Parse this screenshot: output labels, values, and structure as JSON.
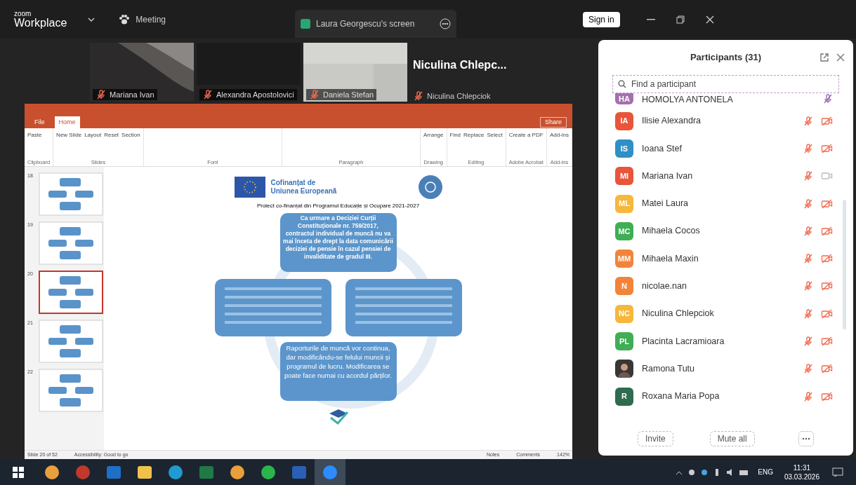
{
  "top_bar": {
    "brand_small": "zoom",
    "brand": "Workplace",
    "meeting_tab": "Meeting",
    "share_tab": "Laura Georgescu's screen",
    "sign_in": "Sign in"
  },
  "videos": [
    {
      "name": "Mariana Ivan",
      "kind": "dark",
      "mic_muted": true
    },
    {
      "name": "Alexandra Apostolovici",
      "kind": "black",
      "mic_muted": true
    },
    {
      "name": "Daniela Stefan",
      "kind": "light",
      "mic_muted": true
    }
  ],
  "active_speaker": {
    "big_name": "Niculina Chlepc...",
    "name": "Niculina Chlepciok",
    "mic_muted": true
  },
  "powerpoint": {
    "tabs": [
      {
        "label": "File",
        "selected": false
      },
      {
        "label": "Home",
        "selected": true
      }
    ],
    "share_button": "Share",
    "ribbon": [
      {
        "name": "Clipboard",
        "items": [
          "Paste"
        ]
      },
      {
        "name": "Slides",
        "items": [
          "New Slide",
          "Layout",
          "Reset",
          "Section"
        ]
      },
      {
        "name": "Font"
      },
      {
        "name": "Paragraph"
      },
      {
        "name": "Drawing",
        "items": [
          "Arrange"
        ]
      },
      {
        "name": "Editing",
        "items": [
          "Find",
          "Replace",
          "Select"
        ]
      },
      {
        "name": "Adobe Acrobat",
        "items": [
          "Create a PDF"
        ]
      },
      {
        "name": "Add-ins",
        "items": [
          "Add-ins"
        ]
      }
    ],
    "thumbnails": [
      {
        "number": "18",
        "selected": false
      },
      {
        "number": "19",
        "selected": false
      },
      {
        "number": "20",
        "selected": true
      },
      {
        "number": "21",
        "selected": false
      },
      {
        "number": "22",
        "selected": false
      }
    ],
    "slide": {
      "eu_text": "Cofinanțat de Uniunea Europeană",
      "subtitle": "Proiect co-finanțat din Programul Educație și Ocupare 2021-2027",
      "top_box": "Ca urmare a Deciziei Curții Constituționale nr. 759/2017, contractul individual de muncă nu va mai înceta de drept la data comunicării deciziei de pensie în cazul pensiei de invaliditate de gradul III.",
      "bottom_box": "Raporturile de muncă vor continua, dar modificându-se felului muncii și programul de lucru. Modificarea se poate face numai cu acordul părților."
    },
    "status": {
      "slide": "Slide 20 of 52",
      "accessibility": "Accessibility: Good to go",
      "notes": "Notes",
      "comments": "Comments",
      "zoom": "142%"
    }
  },
  "participants_panel": {
    "title": "Participants (31)",
    "search": {
      "placeholder": "Find a participant"
    },
    "participants": [
      {
        "initials": "HA",
        "name": "HOMOLYA ANTONELA",
        "color": "#a46fb0",
        "kind": "initials",
        "mic_muted": true,
        "highlighted": true
      },
      {
        "initials": "IA",
        "name": "Ilisie Alexandra",
        "color": "#e8553a",
        "kind": "initials",
        "mic_muted": true,
        "highlighted": false,
        "video_off": true
      },
      {
        "initials": "IS",
        "name": "Ioana Stef",
        "color": "#2f8fc6",
        "kind": "initials",
        "mic_muted": true,
        "highlighted": false,
        "video_off": true
      },
      {
        "initials": "MI",
        "name": "Mariana Ivan",
        "color": "#e8553a",
        "kind": "initials",
        "mic_muted": true,
        "highlighted": false,
        "video_off": false
      },
      {
        "initials": "ML",
        "name": "Matei Laura",
        "color": "#f6b73c",
        "kind": "initials",
        "mic_muted": true,
        "highlighted": false,
        "video_off": true
      },
      {
        "initials": "MC",
        "name": "Mihaela Cocos",
        "color": "#3fae55",
        "kind": "initials",
        "mic_muted": true,
        "highlighted": false,
        "video_off": true
      },
      {
        "initials": "MM",
        "name": "Mihaela Maxin",
        "color": "#f2843a",
        "kind": "initials",
        "mic_muted": true,
        "highlighted": false,
        "video_off": true
      },
      {
        "initials": "N",
        "name": "nicolae.nan",
        "color": "#f2843a",
        "kind": "initials",
        "mic_muted": true,
        "highlighted": false,
        "video_off": true
      },
      {
        "initials": "NC",
        "name": "Niculina Chlepciok",
        "color": "#f6b73c",
        "kind": "initials",
        "mic_muted": true,
        "highlighted": false,
        "video_off": true
      },
      {
        "initials": "PL",
        "name": "Placinta Lacramioara",
        "color": "#3fae55",
        "kind": "initials",
        "mic_muted": true,
        "highlighted": false,
        "video_off": true
      },
      {
        "name": "Ramona Tutu",
        "mic_muted": true,
        "highlighted": false,
        "video_off": true
      },
      {
        "initials": "R",
        "name": "Roxana Maria Popa",
        "color": "#2e6b4f",
        "kind": "initials",
        "mic_muted": true,
        "highlighted": false,
        "video_off": true
      }
    ],
    "buttons": [
      "Invite",
      "Mute all"
    ]
  },
  "taskbar": {
    "apps": [
      {
        "kind": "browser",
        "selected": false
      },
      {
        "kind": "record",
        "selected": false
      },
      {
        "kind": "outlook",
        "selected": false
      },
      {
        "kind": "folder",
        "selected": false
      },
      {
        "kind": "edge",
        "selected": false
      },
      {
        "kind": "excel",
        "selected": false
      },
      {
        "kind": "browser",
        "selected": false
      },
      {
        "kind": "chat",
        "selected": false
      },
      {
        "kind": "word",
        "selected": false
      },
      {
        "kind": "zoom",
        "selected": true
      }
    ],
    "language": "ENG",
    "time": "11:31",
    "date": "03.03.2026"
  }
}
